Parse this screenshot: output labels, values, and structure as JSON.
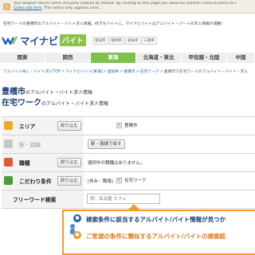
{
  "cookie": {
    "line1": "Your browser blocks some 3rd party cookies by default. By clicking on this page you allow our partner Criteo to place its c",
    "line2_link": "Criteo ads here",
    "line2": ". This notice only appears once."
  },
  "notice": "在宅ワークの豊橋市のアルバイト・バイト求人情報。好きをバイトに。マイナビバイトはアルバイト・パートの求人情報が満載！",
  "logo": {
    "text": "マイナビ",
    "badge": "バイト"
  },
  "regions": [
    "愛知県",
    "静岡県",
    "岐阜県",
    "三重県"
  ],
  "nav": [
    "関東",
    "関西",
    "東海",
    "北海道・東北",
    "甲信越・北陸",
    "中国"
  ],
  "breadcrumb": [
    "アルバイト探し・バイト求人TOP",
    "マイナビバイト[東海]",
    "愛知県",
    "豊橋市",
    "在宅ワーク",
    "豊橋市で在宅ワークのアルバイト・バイト・求人"
  ],
  "heading1": {
    "big": "豊橋市",
    "small": "のアルバイト・バイト求人情報"
  },
  "heading2": {
    "big": "在宅ワーク",
    "small": "のアルバイト・バイト求人情報"
  },
  "search": {
    "area": {
      "label": "エリア",
      "button": "絞り込む",
      "chip": "豊橋市"
    },
    "station": {
      "label": "駅・路線",
      "button": "駅・路線で探す"
    },
    "job": {
      "label": "職種",
      "button": "絞り込む",
      "text": "選択中の職種はありません。"
    },
    "conditions": {
      "label": "こだわり条件",
      "button": "絞り込む",
      "tag": "[休み・職場]",
      "chip": "在宅ワーク"
    },
    "keyword": {
      "label": "フリーワード検索",
      "placeholder": "例：名古屋 カフェ"
    }
  },
  "banner": {
    "line1": "検索条件に該当するアルバイト/バイト情報が見つか",
    "line2": "ご希望の条件に類似するアルバイト/バイトの検索結"
  },
  "colors": {
    "accent": "#7ec04e",
    "brand": "#1d4f9c",
    "banner_border": "#f39a2e"
  }
}
